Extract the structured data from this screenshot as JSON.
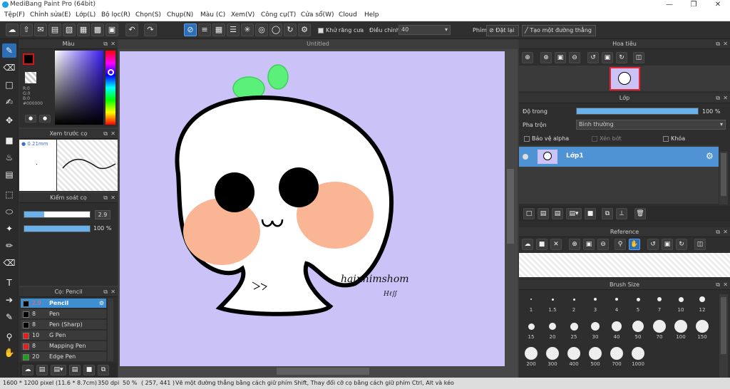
{
  "window": {
    "title": "MediBang Paint Pro (64bit)"
  },
  "menu": [
    "Tệp(F)",
    "Chỉnh sửa(E)",
    "Lớp(L)",
    "Bộ lọc(R)",
    "Chọn(S)",
    "Chụp(N)",
    "Màu (C)",
    "Xem(V)",
    "Công cụ(T)",
    "Cửa sổ(W)",
    "Cloud",
    "Help"
  ],
  "toolbar": {
    "antialias_label": "Khử răng cưa",
    "adjust_label": "Điều chỉnh",
    "adjust_value": "40",
    "key_label": "Phím",
    "reset_label": "Đặt lại",
    "straight_line_label": "Tạo một đường thẳng"
  },
  "color_panel": {
    "title": "Màu",
    "r": "R:0",
    "g": "G:0",
    "b": "B:0",
    "hex": "#000000"
  },
  "preview_panel": {
    "title": "Xem trước cọ",
    "size": "0.21mm"
  },
  "brush_control": {
    "title": "Kiểm soát cọ",
    "size_value": "2.9",
    "opacity_value": "100 %",
    "size_fraction": 0.3,
    "opacity_fraction": 1.0
  },
  "brush_panel": {
    "title": "Cọ: Pencil",
    "items": [
      {
        "size": "2.9",
        "name": "Pencil",
        "color": "#000000"
      },
      {
        "size": "8",
        "name": "Pen",
        "color": "#000000"
      },
      {
        "size": "8",
        "name": "Pen (Sharp)",
        "color": "#000000"
      },
      {
        "size": "10",
        "name": "G Pen",
        "color": "#e0201c"
      },
      {
        "size": "8",
        "name": "Mapping Pen",
        "color": "#e0201c"
      },
      {
        "size": "20",
        "name": "Edge Pen",
        "color": "#1ca01c"
      }
    ]
  },
  "document": {
    "tab": "Untitled",
    "signature": "hainhimshom"
  },
  "navigator": {
    "title": "Hoa tiêu"
  },
  "layers": {
    "title": "Lớp",
    "opacity_label": "Độ trong",
    "opacity_value": "100 %",
    "opacity_fraction": 1.0,
    "blend_label": "Pha trộn",
    "blend_value": "Bình thường",
    "protect_alpha": "Bảo vệ alpha",
    "clipping": "Xén bớt",
    "lock": "Khóa",
    "layer_name": "Lớp1"
  },
  "reference": {
    "title": "Reference"
  },
  "brush_size": {
    "title": "Brush Size",
    "sizes": [
      "1",
      "1.5",
      "2",
      "3",
      "4",
      "5",
      "7",
      "10",
      "12",
      "15",
      "20",
      "25",
      "30",
      "40",
      "50",
      "70",
      "100",
      "150",
      "200",
      "300",
      "400",
      "500",
      "700",
      "1000"
    ]
  },
  "status": {
    "dims": "1600 * 1200 pixel",
    "size_cm": "(11.6 * 8.7cm)",
    "dpi": "350 dpi",
    "zoom": "50 %",
    "coords": "( 257, 441 )",
    "hint": "Vẽ một đường thẳng bằng cách giữ phím Shift, Thay đổi cỡ cọ bằng cách giữ phím Ctrl, Alt và kéo"
  }
}
